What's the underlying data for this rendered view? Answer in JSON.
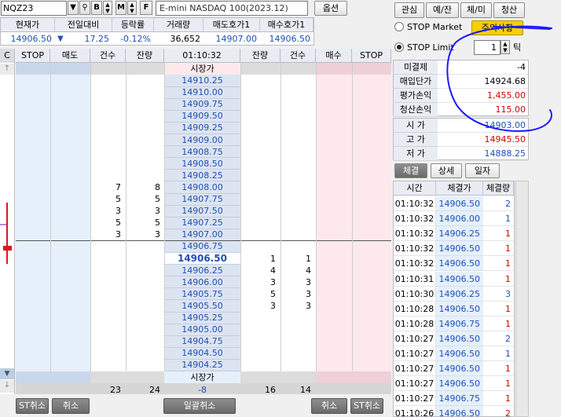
{
  "toolbar": {
    "symbol": "NQZ23",
    "product_name": "E-mini NASDAQ 100(2023.12)",
    "options_label": "옵션",
    "b_label": "B",
    "m_label": "M",
    "f_label": "F"
  },
  "quote_headers": [
    "현재가",
    "전일대비",
    "등락률",
    "거래량",
    "매도호가1",
    "매수호가1"
  ],
  "quote_values": {
    "current": "14906.50",
    "change_arrow": "▼",
    "change": "17.25",
    "rate": "-0.12%",
    "volume": "36,652",
    "ask1": "14907.00",
    "bid1": "14906.50"
  },
  "grid_headers": [
    "STOP",
    "매도",
    "건수",
    "잔량",
    "01:10:32",
    "잔량",
    "건수",
    "매수",
    "STOP"
  ],
  "corner_label": "C",
  "market_price_label": "시장가",
  "ladder": [
    {
      "price": "14910.25"
    },
    {
      "price": "14910.00"
    },
    {
      "price": "14909.75"
    },
    {
      "price": "14909.50"
    },
    {
      "price": "14909.25"
    },
    {
      "price": "14909.00"
    },
    {
      "price": "14908.75"
    },
    {
      "price": "14908.50"
    },
    {
      "price": "14908.25"
    },
    {
      "price": "14908.00",
      "ask_cnt": "7",
      "ask_qty": "8"
    },
    {
      "price": "14907.75",
      "ask_cnt": "5",
      "ask_qty": "5"
    },
    {
      "price": "14907.50",
      "ask_cnt": "3",
      "ask_qty": "3"
    },
    {
      "price": "14907.25",
      "ask_cnt": "5",
      "ask_qty": "5"
    },
    {
      "price": "14907.00",
      "ask_cnt": "3",
      "ask_qty": "3"
    },
    {
      "price": "14906.75"
    },
    {
      "price": "14906.50",
      "bid_qty": "1",
      "bid_cnt": "1",
      "current": true
    },
    {
      "price": "14906.25",
      "bid_qty": "4",
      "bid_cnt": "4"
    },
    {
      "price": "14906.00",
      "bid_qty": "3",
      "bid_cnt": "3"
    },
    {
      "price": "14905.75",
      "bid_qty": "5",
      "bid_cnt": "3"
    },
    {
      "price": "14905.50",
      "bid_qty": "3",
      "bid_cnt": "3"
    },
    {
      "price": "14905.25"
    },
    {
      "price": "14905.00"
    },
    {
      "price": "14904.75"
    },
    {
      "price": "14904.50"
    },
    {
      "price": "14904.25"
    }
  ],
  "totals": {
    "ask_cnt": "23",
    "ask_qty": "24",
    "diff": "-8",
    "bid_qty": "16",
    "bid_cnt": "14"
  },
  "bottom_buttons": {
    "st_cancel_left": "ST취소",
    "cancel_left": "취소",
    "cancel_all": "일괄취소",
    "cancel_right": "취소",
    "st_cancel_right": "ST취소"
  },
  "side_tabs": [
    "관심",
    "예/잔",
    "체/미",
    "청산"
  ],
  "stop": {
    "market_label": "STOP Market",
    "limit_label": "STOP Limit",
    "notice_button": "주의사항",
    "tick_value": "1",
    "tick_label": "틱"
  },
  "position": [
    {
      "label": "미결제",
      "value": "-4",
      "color": "#000000"
    },
    {
      "label": "매입단가",
      "value": "14924.68",
      "color": "#000000"
    },
    {
      "label": "평가손익",
      "value": "1,455.00",
      "color": "#d00000"
    },
    {
      "label": "청산손익",
      "value": "115.00",
      "color": "#d00000"
    }
  ],
  "ohl": [
    {
      "label": "시 가",
      "value": "14903.00",
      "color": "#1f4fb5"
    },
    {
      "label": "고 가",
      "value": "14945.50",
      "color": "#d00000"
    },
    {
      "label": "저 가",
      "value": "14888.25",
      "color": "#1f4fb5"
    }
  ],
  "trade_tabs": [
    "체결",
    "상세",
    "일자"
  ],
  "trade_headers": [
    "시간",
    "체결가",
    "체결량"
  ],
  "trades": [
    {
      "time": "01:10:32",
      "price": "14906.50",
      "qty": "2",
      "color": "#1f4fb5"
    },
    {
      "time": "01:10:32",
      "price": "14906.00",
      "qty": "1",
      "color": "#1f4fb5"
    },
    {
      "time": "01:10:32",
      "price": "14906.25",
      "qty": "1",
      "color": "#d00000"
    },
    {
      "time": "01:10:32",
      "price": "14906.50",
      "qty": "1",
      "color": "#d00000"
    },
    {
      "time": "01:10:32",
      "price": "14906.50",
      "qty": "1",
      "color": "#d00000"
    },
    {
      "time": "01:10:31",
      "price": "14906.50",
      "qty": "1",
      "color": "#d00000"
    },
    {
      "time": "01:10:30",
      "price": "14906.25",
      "qty": "3",
      "color": "#1f4fb5"
    },
    {
      "time": "01:10:28",
      "price": "14906.50",
      "qty": "1",
      "color": "#d00000"
    },
    {
      "time": "01:10:28",
      "price": "14906.75",
      "qty": "1",
      "color": "#d00000"
    },
    {
      "time": "01:10:27",
      "price": "14906.50",
      "qty": "2",
      "color": "#1f4fb5"
    },
    {
      "time": "01:10:27",
      "price": "14906.50",
      "qty": "1",
      "color": "#1f4fb5"
    },
    {
      "time": "01:10:27",
      "price": "14906.50",
      "qty": "1",
      "color": "#d00000"
    },
    {
      "time": "01:10:27",
      "price": "14906.50",
      "qty": "1",
      "color": "#d00000"
    },
    {
      "time": "01:10:27",
      "price": "14906.75",
      "qty": "1",
      "color": "#d00000"
    },
    {
      "time": "01:10:26",
      "price": "14906.50",
      "qty": "2",
      "color": "#d00000"
    }
  ],
  "colors": {
    "ask_bg": "#e6f0fb",
    "bid_bg": "#fde9ec",
    "price_bg": "#dce4f2",
    "annotation": "#1a1aff",
    "notice_bg": "#f8d000"
  }
}
